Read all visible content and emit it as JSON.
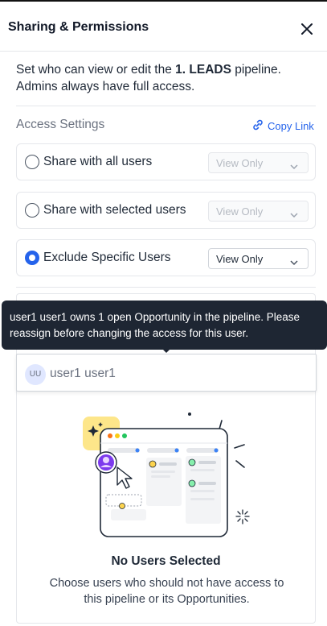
{
  "dialog": {
    "title": "Sharing & Permissions",
    "close_icon": "close-icon"
  },
  "description": {
    "prefix": "Set who can view or edit the ",
    "pipeline": "1. LEADS",
    "suffix": " pipeline. Admins always have full access."
  },
  "access": {
    "label": "Access Settings",
    "copy_link": "Copy Link",
    "options": [
      {
        "label": "Share with all users",
        "selected": false,
        "permission": "View Only",
        "enabled": false
      },
      {
        "label": "Share with selected users",
        "selected": false,
        "permission": "View Only",
        "enabled": false
      },
      {
        "label": "Exclude Specific Users",
        "selected": true,
        "permission": "View Only",
        "enabled": true
      }
    ]
  },
  "tooltip": {
    "text": "user1 user1 owns 1 open Opportunity in the pipeline. Please reassign before changing the access for this user."
  },
  "user_field": {
    "initials": "UU",
    "name": "user1 user1"
  },
  "empty_state": {
    "title": "No Users Selected",
    "description": "Choose users who should not have access to this pipeline or its Opportunities."
  },
  "colors": {
    "accent": "#2563eb",
    "tooltip_bg": "#1e2633",
    "illustration_yellow": "#fde68a",
    "avatar_purple": "#7c3aed"
  }
}
